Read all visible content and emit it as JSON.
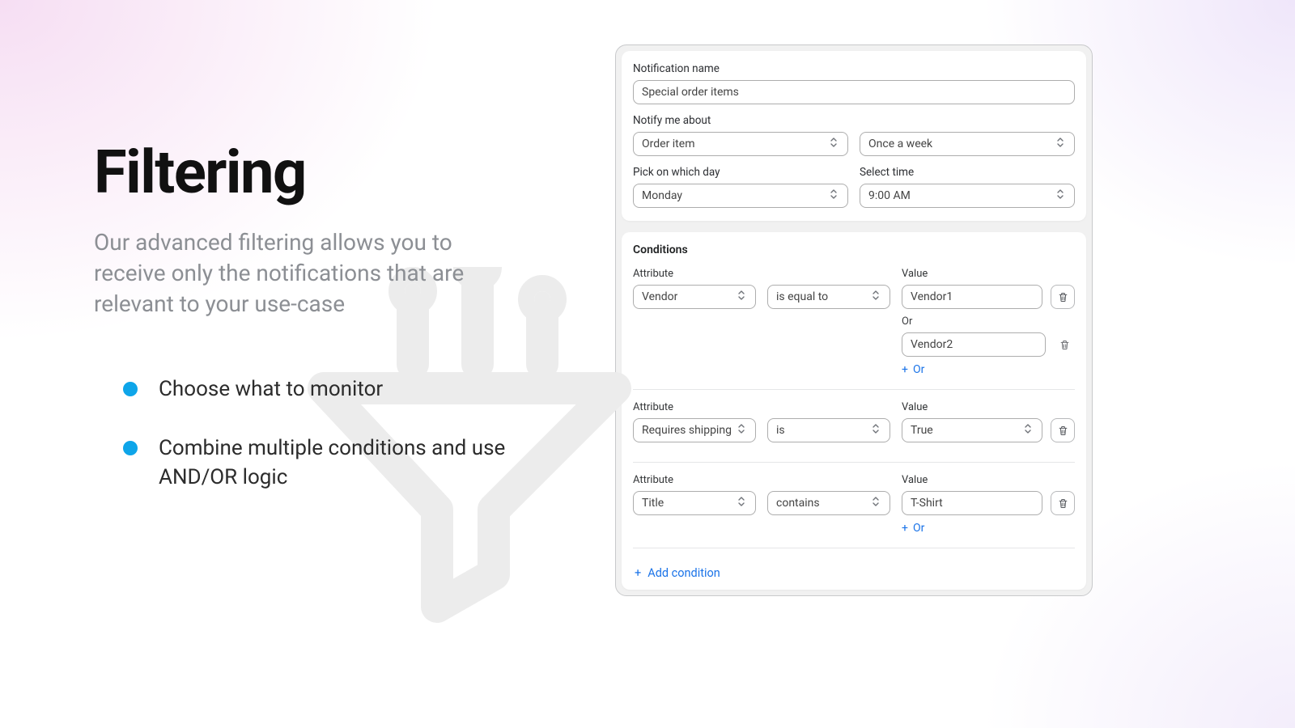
{
  "hero": {
    "title": "Filtering",
    "subtitle": "Our advanced filtering allows you to receive only the notifications that are relevant to your use-case",
    "features": [
      "Choose what to monitor",
      "Combine multiple conditions and use AND/OR logic"
    ]
  },
  "form": {
    "name_label": "Notification name",
    "name_value": "Special order items",
    "notify_label": "Notify me about",
    "notify_value": "Order item",
    "freq_value": "Once a week",
    "day_label": "Pick on which day",
    "day_value": "Monday",
    "time_label": "Select time",
    "time_value": "9:00 AM"
  },
  "conditions": {
    "title": "Conditions",
    "attribute_label": "Attribute",
    "value_label": "Value",
    "or_label": "Or",
    "add_or": "Or",
    "add_condition": "Add condition",
    "rows": [
      {
        "attr": "Vendor",
        "op": "is equal to",
        "values": [
          "Vendor1",
          "Vendor2"
        ],
        "show_add_or": true
      },
      {
        "attr": "Requires shipping",
        "op": "is",
        "values": [
          "True"
        ],
        "value_is_select": true,
        "show_add_or": false
      },
      {
        "attr": "Title",
        "op": "contains",
        "values": [
          "T-Shirt"
        ],
        "show_add_or": true
      }
    ]
  }
}
